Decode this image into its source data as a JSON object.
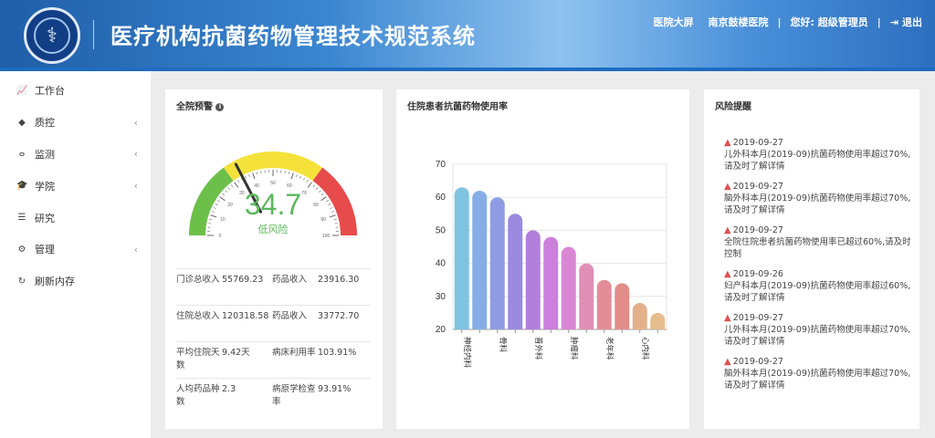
{
  "header": {
    "title": "医疗机构抗菌药物管理技术规范系统",
    "nav": {
      "screen": "医院大屏",
      "hospital": "南京鼓楼医院",
      "greeting": "您好: 超级管理员",
      "logout": "退出"
    }
  },
  "sidebar": {
    "items": [
      {
        "label": "工作台",
        "icon": "chart-line-icon",
        "chev": false
      },
      {
        "label": "质控",
        "icon": "shield-icon",
        "chev": true
      },
      {
        "label": "监测",
        "icon": "stethoscope-icon",
        "chev": true
      },
      {
        "label": "学院",
        "icon": "graduation-cap-icon",
        "chev": true
      },
      {
        "label": "研究",
        "icon": "database-icon",
        "chev": false
      },
      {
        "label": "管理",
        "icon": "gear-icon",
        "chev": true
      },
      {
        "label": "刷新内存",
        "icon": "refresh-icon",
        "chev": false
      }
    ]
  },
  "warning": {
    "title": "全院预警",
    "gauge": {
      "value": 34.7,
      "display": "34.7",
      "label": "低风险",
      "min": 0,
      "max": 100,
      "ticks": [
        "0",
        "10",
        "20",
        "30",
        "40",
        "50",
        "60",
        "70",
        "80",
        "90",
        "100"
      ],
      "colors": {
        "low": "#6cc04a",
        "mid": "#f4e23b",
        "high": "#e84b4b"
      }
    },
    "stats": [
      [
        "门诊总收入",
        "55769.23",
        "药品收入",
        "23916.30"
      ],
      [
        "住院总收入",
        "120318.58",
        "药品收入",
        "33772.70"
      ],
      [
        "平均住院天数",
        "9.42天",
        "病床利用率",
        "103.91%"
      ],
      [
        "人均药品种数",
        "2.3",
        "病原学检查率",
        "93.91%"
      ]
    ]
  },
  "usage": {
    "title": "住院患者抗菌药物使用率",
    "chart_data": {
      "type": "bar",
      "categories": [
        "神经内科",
        "",
        "骨科",
        "",
        "普外科",
        "",
        "肿瘤科",
        "",
        "老年科",
        "",
        "心内科",
        ""
      ],
      "values": [
        63,
        62,
        60,
        55,
        50,
        48,
        45,
        40,
        35,
        34,
        28,
        25
      ],
      "ylim": [
        20,
        70
      ],
      "yticks": [
        "20",
        "30",
        "40",
        "50",
        "60",
        "70"
      ],
      "colors": [
        "#7ec3e1",
        "#86aee5",
        "#8f9ce3",
        "#9a8ae0",
        "#b27fdc",
        "#cb80dc",
        "#d987d4",
        "#e08eb6",
        "#e38d98",
        "#e38d8b",
        "#e4b08c",
        "#e6bd8c"
      ],
      "grid": true
    }
  },
  "risk": {
    "title": "风险提醒",
    "alerts": [
      {
        "date": "2019-09-27",
        "text": "儿外科本月(2019-09)抗菌药物使用率超过70%,请及时了解详情"
      },
      {
        "date": "2019-09-27",
        "text": "脑外科本月(2019-09)抗菌药物使用率超过70%,请及时了解详情"
      },
      {
        "date": "2019-09-27",
        "text": "全院住院患者抗菌药物使用率已超过60%,请及时控制"
      },
      {
        "date": "2019-09-26",
        "text": "妇产科本月(2019-09)抗菌药物使用率超过60%,请及时了解详情"
      },
      {
        "date": "2019-09-27",
        "text": "儿外科本月(2019-09)抗菌药物使用率超过70%,请及时了解详情"
      },
      {
        "date": "2019-09-27",
        "text": "脑外科本月(2019-09)抗菌药物使用率超过70%,请及时了解详情"
      }
    ]
  }
}
